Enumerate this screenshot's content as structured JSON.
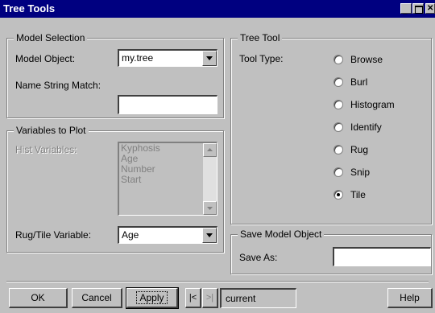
{
  "window": {
    "title": "Tree Tools",
    "controls": {
      "minimize": "▁",
      "maximize": "□",
      "close": "✕"
    }
  },
  "model_selection": {
    "legend": "Model Selection",
    "model_object_label": "Model Object:",
    "model_object_value": "my.tree",
    "name_string_label": "Name String Match:",
    "name_string_value": ""
  },
  "variables_to_plot": {
    "legend": "Variables to Plot",
    "hist_label": "Hist Variables:",
    "hist_items": [
      "Kyphosis",
      "Age",
      "Number",
      "Start"
    ],
    "rug_tile_label": "Rug/Tile Variable:",
    "rug_tile_value": "Age"
  },
  "tree_tool": {
    "legend": "Tree Tool",
    "tool_type_label": "Tool Type:",
    "options": [
      "Browse",
      "Burl",
      "Histogram",
      "Identify",
      "Rug",
      "Snip",
      "Tile"
    ],
    "selected": "Tile"
  },
  "save_model_object": {
    "legend": "Save Model Object",
    "save_as_label": "Save As:",
    "save_as_value": ""
  },
  "buttons": {
    "ok": "OK",
    "cancel": "Cancel",
    "apply": "Apply",
    "prev": "|<",
    "next": ">|",
    "current": "current",
    "help": "Help"
  }
}
